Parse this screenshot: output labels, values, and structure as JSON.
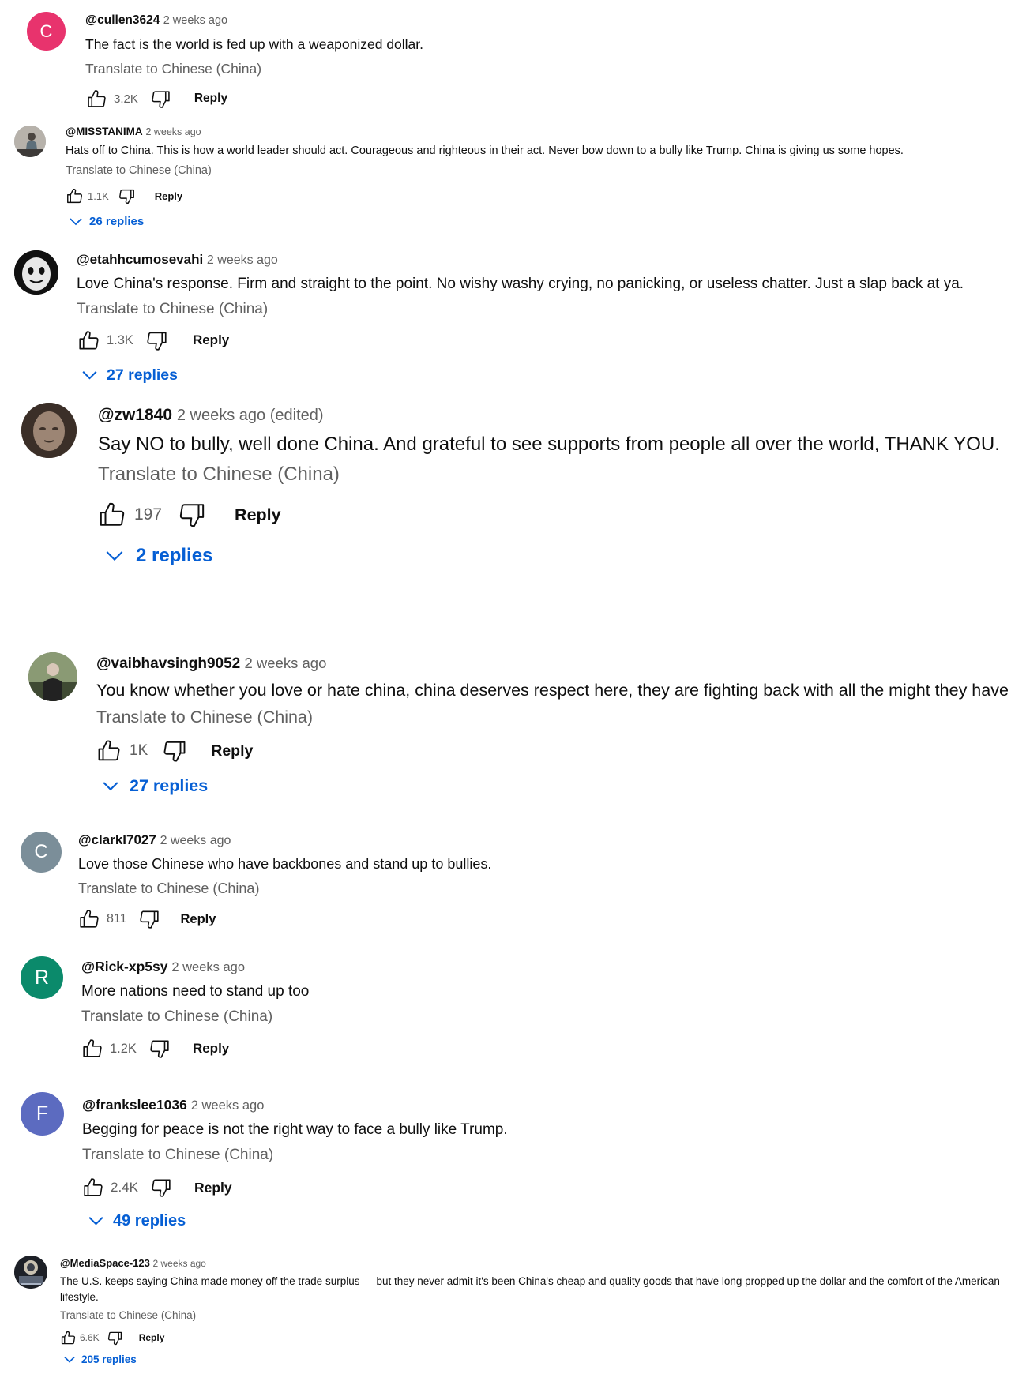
{
  "common": {
    "translate_label": "Translate to Chinese (China)",
    "reply_label": "Reply"
  },
  "comments": [
    {
      "handle": "@cullen3624",
      "time": "2 weeks ago",
      "text": "The fact is the world is fed up with a weaponized dollar.",
      "likes": "3.2K",
      "avatar_letter": "C",
      "avatar_color": "#e8336d"
    },
    {
      "handle": "@MISSTANIMA",
      "time": "2 weeks ago",
      "text": "Hats off to China. This is how a world leader should act. Courageous and righteous in their act. Never bow down to a bully like Trump. China is giving us some hopes.",
      "likes": "1.1K",
      "replies": "26 replies"
    },
    {
      "handle": "@etahhcumosevahi",
      "time": "2 weeks ago",
      "text": "Love China's response. Firm and straight to the point. No wishy washy crying, no panicking, or useless chatter. Just a slap back at ya.",
      "likes": "1.3K",
      "replies": "27 replies"
    },
    {
      "handle": "@zw1840",
      "time": "2 weeks ago (edited)",
      "text": "Say NO to bully, well done China. And grateful to see supports from people all over the world, THANK YOU.",
      "likes": "197",
      "replies": "2 replies"
    },
    {
      "handle": "@vaibhavsingh9052",
      "time": "2 weeks ago",
      "text": "You know whether you love or hate china, china deserves respect here, they are fighting back with all the might they have",
      "likes": "1K",
      "replies": "27 replies"
    },
    {
      "handle": "@clarkl7027",
      "time": "2 weeks ago",
      "text": "Love those Chinese who have backbones and stand up to bullies.",
      "likes": "811",
      "avatar_letter": "C",
      "avatar_color": "#7b8e99"
    },
    {
      "handle": "@Rick-xp5sy",
      "time": "2 weeks ago",
      "text": "More nations need to stand up too",
      "likes": "1.2K",
      "avatar_letter": "R",
      "avatar_color": "#0b8a6b"
    },
    {
      "handle": "@frankslee1036",
      "time": "2 weeks ago",
      "text": "Begging for peace is not the right way to face a bully like Trump.",
      "likes": "2.4K",
      "replies": "49 replies",
      "avatar_letter": "F",
      "avatar_color": "#5c6bc0"
    },
    {
      "handle": "@MediaSpace-123",
      "time": "2 weeks ago",
      "text": "The U.S. keeps saying China made money off the trade surplus — but they never admit it's been China's cheap and quality goods that have long propped up the dollar and the comfort of the American lifestyle.",
      "likes": "6.6K",
      "replies": "205 replies"
    }
  ]
}
